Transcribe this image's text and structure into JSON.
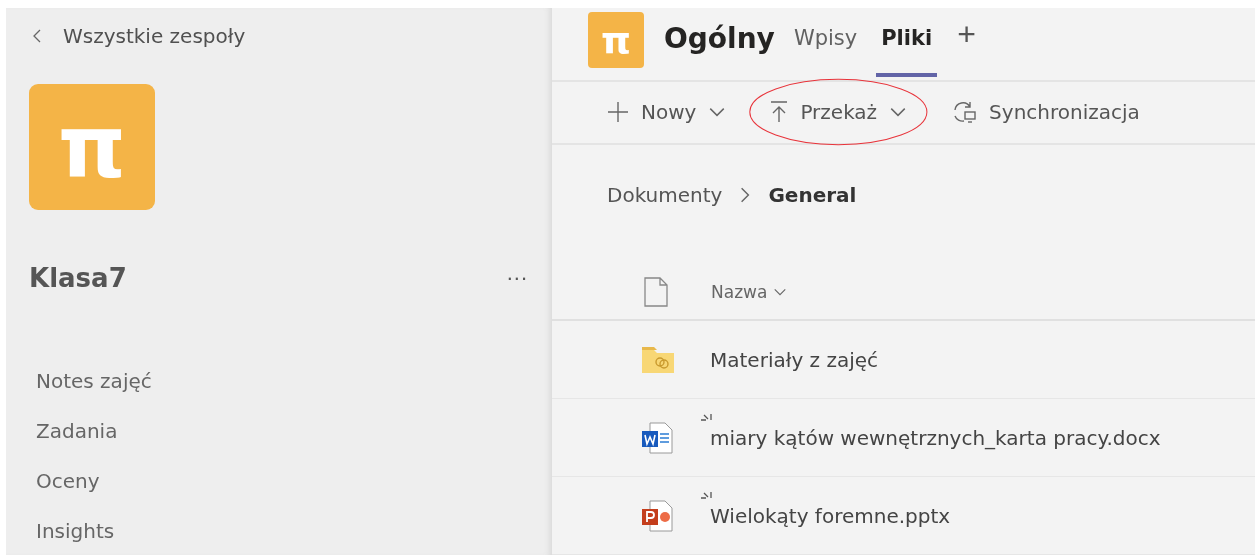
{
  "sidebar": {
    "back_link": "Wszystkie zespoły",
    "team_logo": "π",
    "team_name": "Klasa7",
    "more_button": "...",
    "items": [
      {
        "label": "Notes zajęć"
      },
      {
        "label": "Zadania"
      },
      {
        "label": "Oceny"
      },
      {
        "label": "Insights"
      }
    ]
  },
  "header": {
    "channel_logo": "π",
    "channel_name": "Ogólny",
    "tabs": [
      {
        "label": "Wpisy",
        "selected": false
      },
      {
        "label": "Pliki",
        "selected": true
      }
    ],
    "add_tab": "+"
  },
  "toolbar": [
    {
      "kind": "new",
      "label": "Nowy",
      "dropdown": true,
      "circled": false
    },
    {
      "kind": "upload",
      "label": "Przekaż",
      "dropdown": true,
      "circled": true
    },
    {
      "kind": "sync",
      "label": "Synchronizacja",
      "dropdown": false,
      "circled": false
    }
  ],
  "breadcrumb": [
    "Dokumenty",
    "General"
  ],
  "table": {
    "columns": [
      {
        "label": "Nazwa",
        "sortable": true
      }
    ],
    "rows": [
      {
        "kind": "folder",
        "name": "Materiały z zajęć",
        "new": false
      },
      {
        "kind": "word",
        "name": "miary kątów wewnętrznych_karta pracy.docx",
        "new": true
      },
      {
        "kind": "powerpoint",
        "name": "Wielokąty foremne.pptx",
        "new": true
      }
    ]
  }
}
